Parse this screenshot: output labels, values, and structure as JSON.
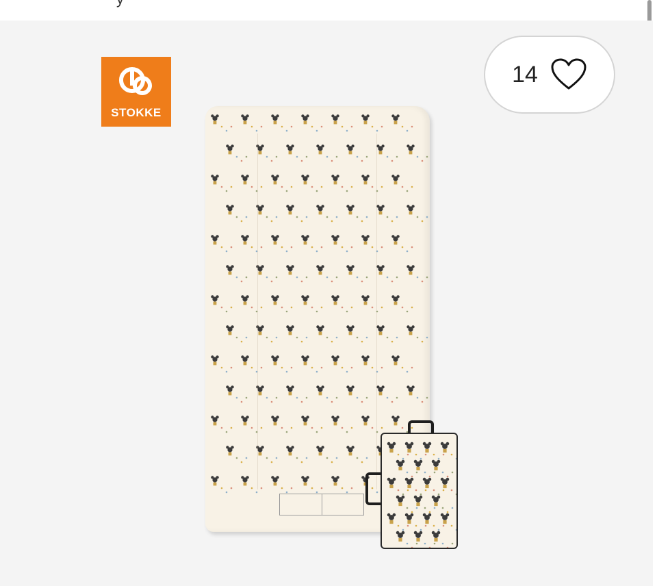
{
  "top_bar": {
    "partial_text": "y"
  },
  "brand": {
    "name": "STOKKE",
    "color": "#ef7d1a"
  },
  "like": {
    "count": "14",
    "icon": "heart-icon"
  },
  "product": {
    "image": "mattress-with-carry-bag",
    "print_color": "#f8f2e6"
  }
}
